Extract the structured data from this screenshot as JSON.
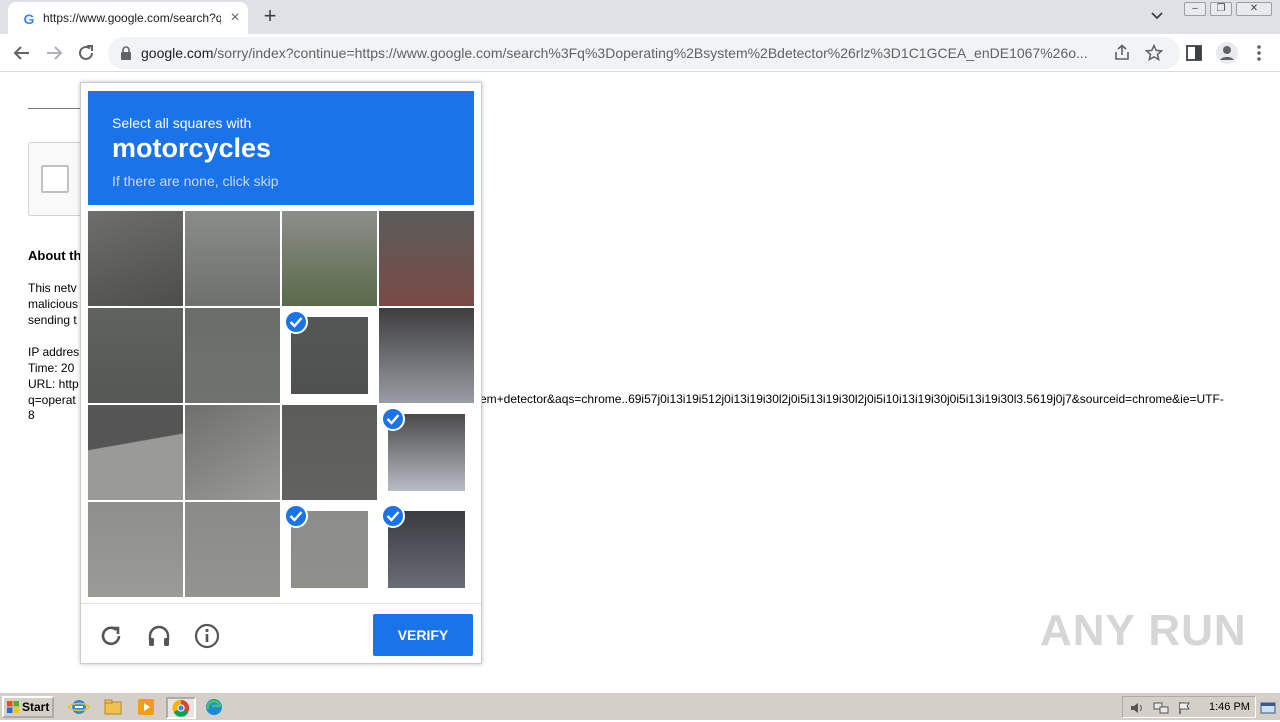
{
  "browser": {
    "tab": {
      "title": "https://www.google.com/search?q=",
      "favicon": "google-g-icon"
    },
    "url": {
      "host": "google.com",
      "rest": "/sorry/index?continue=https://www.google.com/search%3Fq%3Doperating%2Bsystem%2Bdetector%26rlz%3D1C1GCEA_enDE1067%26o..."
    }
  },
  "page": {
    "about_title": "About th",
    "paragraph": [
      "This netv",
      "malicious",
      "sending t"
    ],
    "info": [
      "IP addres",
      "Time: 20",
      "URL: http"
    ],
    "url_line_start": "q=operat",
    "url_line_tail": "em+detector&aqs=chrome..69i57j0i13i19i512j0i13i19i30l2j0i5i13i19i30l2j0i5i10i13i19i30j0i5i13i19i30l3.5619j0j7&sourceid=chrome&ie=UTF-",
    "url_line_end": "8"
  },
  "challenge": {
    "instruction": "Select all squares with",
    "target": "motorcycles",
    "hint": "If there are none, click skip",
    "tiles_selected": [
      false,
      false,
      false,
      false,
      false,
      false,
      true,
      false,
      false,
      false,
      false,
      true,
      false,
      false,
      true,
      true
    ],
    "verify_label": "VERIFY",
    "icons": [
      "reload-icon",
      "audio-icon",
      "info-icon"
    ]
  },
  "watermark": "ANY RUN",
  "taskbar": {
    "start_label": "Start",
    "clock": "1:46 PM",
    "apps": [
      "ie-icon",
      "explorer-icon",
      "media-player-icon",
      "chrome-icon",
      "edge-icon"
    ]
  }
}
